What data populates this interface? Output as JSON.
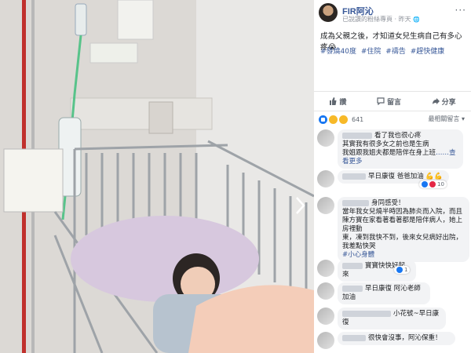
{
  "post": {
    "page_name": "FIR阿沁",
    "meta": "已說讚的粉絲專頁 · 昨天",
    "globe_icon": "globe-icon",
    "text": "成為父親之後，才知道女兒生病自己有多心疼😭",
    "tags": [
      "#發燒40度",
      "#住院",
      "#禱告",
      "#趕快健康"
    ]
  },
  "actions": {
    "like": "讚",
    "comment": "留言",
    "share": "分享"
  },
  "reactions": {
    "count": "641",
    "sort_label": "最相關留言 ▾"
  },
  "comments": [
    {
      "lines": [
        "看了我也很心疼",
        "其實我有很多女之前也是生病",
        "我姐跟我姐夫都是陪伴在身上班"
      ],
      "see_more": "……查看更多"
    },
    {
      "lines": [
        "早日康復 爸爸加油 💪💪"
      ],
      "likes": "10"
    },
    {
      "lines": [
        "身同感受！",
        "當年我女兒燒半時因為肺炎而入院，而且",
        "陳方寶在家看著看著都是陪伴病人，她上房裡動",
        "東，凍到我快不到，後來女兒病好出院，",
        "我差點快哭",
        "#小心身體"
      ]
    },
    {
      "lines": [
        "寶寶快快好起來"
      ],
      "likes": "1"
    },
    {
      "lines": [
        "早日康復 阿沁老師加油"
      ]
    },
    {
      "lines": [
        "小花號~早日康復"
      ]
    },
    {
      "lines": [
        "很快會沒事，阿沁保重！"
      ]
    }
  ],
  "colors": {
    "link": "#385898",
    "bubble": "#f2f3f5",
    "like_blue": "#1877f2"
  }
}
